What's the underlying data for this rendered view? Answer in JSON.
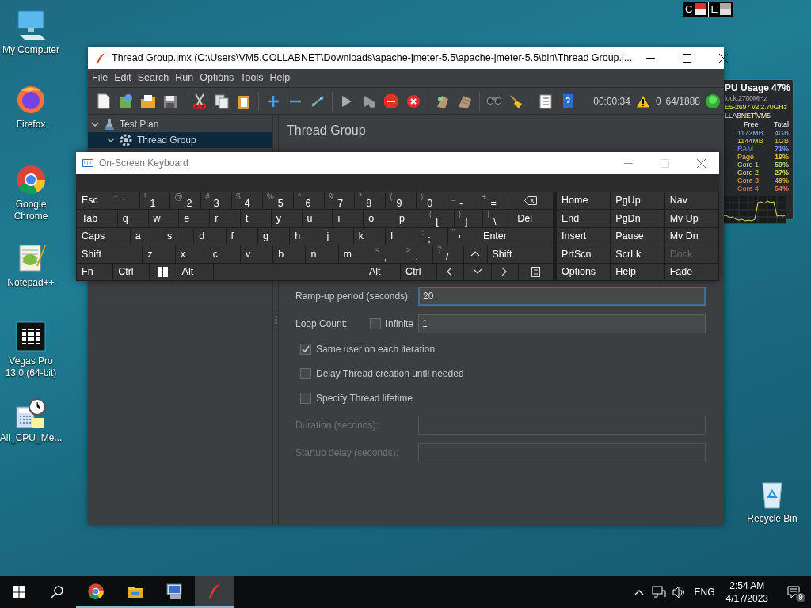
{
  "desktop_icons": [
    {
      "kind": "computer",
      "label": "My Computer"
    },
    {
      "kind": "firefox",
      "label": "Firefox"
    },
    {
      "kind": "chrome",
      "label": "Google Chrome"
    },
    {
      "kind": "notepad",
      "label": "Notepad++"
    },
    {
      "kind": "vegas",
      "label": "Vegas Pro 13.0 (64-bit)"
    },
    {
      "kind": "calc",
      "label": "All_CPU_Me..."
    },
    {
      "kind": "recycle",
      "label": "Recycle Bin"
    }
  ],
  "top_widget": {
    "left": "C",
    "right": "E"
  },
  "cpu_gadget": {
    "title": "PU Usage",
    "usage": "47%",
    "lines": [
      "lock:2700MHz",
      "E5-2697 v2 2.70GHz",
      "LLABNET\\VM5"
    ],
    "columns": [
      "Free",
      "Total"
    ],
    "memory": [
      {
        "free": "1172MB",
        "total": "4GB",
        "color": "#8fb4ea"
      },
      {
        "free": "1144MB",
        "total": "1GB",
        "color": "#e8c040"
      }
    ],
    "meters": [
      {
        "label": "RAM",
        "value": "71%",
        "color": "#7c9cff"
      },
      {
        "label": "Page",
        "value": "19%",
        "color": "#e8c040"
      },
      {
        "label": "Core 1",
        "value": "59%",
        "color": "#b8e080"
      },
      {
        "label": "Core 2",
        "value": "27%",
        "color": "#d8e060"
      },
      {
        "label": "Core 3",
        "value": "49%",
        "color": "#e8a840"
      },
      {
        "label": "Core 4",
        "value": "54%",
        "color": "#e87848"
      }
    ]
  },
  "jmeter": {
    "title": "Thread Group.jmx (C:\\Users\\VM5.COLLABNET\\Downloads\\apache-jmeter-5.5\\apache-jmeter-5.5\\bin\\Thread Group.j...",
    "menu": [
      "File",
      "Edit",
      "Search",
      "Run",
      "Options",
      "Tools",
      "Help"
    ],
    "status": {
      "elapsed": "00:00:34",
      "warnings": "0",
      "threads": "64/1888"
    },
    "tree": [
      {
        "label": "Test Plan",
        "expanded": true,
        "selected": false,
        "children": [
          {
            "label": "Thread Group",
            "expanded": true,
            "selected": true
          }
        ]
      }
    ],
    "panel_title": "Thread Group",
    "fields": [
      {
        "label": "Ramp-up period (seconds):",
        "value": "20",
        "focused": true
      },
      {
        "label": "Loop Count:",
        "checkbox": {
          "label": "Infinite",
          "checked": false
        },
        "value": "1",
        "focused": false
      }
    ],
    "options": [
      {
        "label": "Same user on each iteration",
        "checked": true
      },
      {
        "label": "Delay Thread creation until needed",
        "checked": false
      },
      {
        "label": "Specify Thread lifetime",
        "checked": false
      }
    ],
    "lifetime_fields": [
      {
        "label": "Duration (seconds):",
        "disabled": true
      },
      {
        "label": "Startup delay (seconds):",
        "disabled": true
      }
    ]
  },
  "keyboard": {
    "title": "On-Screen Keyboard",
    "rows": [
      {
        "keys": [
          {
            "kind": "text",
            "label": "Esc"
          },
          {
            "kind": "char",
            "shift": "~",
            "main": "`"
          },
          {
            "kind": "char",
            "shift": "!",
            "main": "1"
          },
          {
            "kind": "char",
            "shift": "@",
            "main": "2"
          },
          {
            "kind": "char",
            "shift": "#",
            "main": "3"
          },
          {
            "kind": "char",
            "shift": "$",
            "main": "4"
          },
          {
            "kind": "char",
            "shift": "%",
            "main": "5"
          },
          {
            "kind": "char",
            "shift": "^",
            "main": "6"
          },
          {
            "kind": "char",
            "shift": "&",
            "main": "7"
          },
          {
            "kind": "char",
            "shift": "*",
            "main": "8"
          },
          {
            "kind": "char",
            "shift": "(",
            "main": "9"
          },
          {
            "kind": "char",
            "shift": ")",
            "main": "0"
          },
          {
            "kind": "char",
            "shift": "_",
            "main": "-"
          },
          {
            "kind": "char",
            "shift": "+",
            "main": "="
          },
          {
            "kind": "backspace"
          }
        ]
      },
      {
        "keys": [
          {
            "kind": "text",
            "label": "Tab"
          },
          {
            "kind": "text",
            "label": "q"
          },
          {
            "kind": "text",
            "label": "w"
          },
          {
            "kind": "text",
            "label": "e"
          },
          {
            "kind": "text",
            "label": "r"
          },
          {
            "kind": "text",
            "label": "t"
          },
          {
            "kind": "text",
            "label": "y"
          },
          {
            "kind": "text",
            "label": "u"
          },
          {
            "kind": "text",
            "label": "i"
          },
          {
            "kind": "text",
            "label": "o"
          },
          {
            "kind": "text",
            "label": "p"
          },
          {
            "kind": "char",
            "shift": "{",
            "main": "["
          },
          {
            "kind": "char",
            "shift": "}",
            "main": "]"
          },
          {
            "kind": "char",
            "shift": "|",
            "main": "\\"
          },
          {
            "kind": "text",
            "label": "Del"
          }
        ]
      },
      {
        "keys": [
          {
            "kind": "text",
            "label": "Caps"
          },
          {
            "kind": "text",
            "label": "a"
          },
          {
            "kind": "text",
            "label": "s"
          },
          {
            "kind": "text",
            "label": "d"
          },
          {
            "kind": "text",
            "label": "f"
          },
          {
            "kind": "text",
            "label": "g"
          },
          {
            "kind": "text",
            "label": "h"
          },
          {
            "kind": "text",
            "label": "j"
          },
          {
            "kind": "text",
            "label": "k"
          },
          {
            "kind": "text",
            "label": "l"
          },
          {
            "kind": "char",
            "shift": ":",
            "main": ";"
          },
          {
            "kind": "char",
            "shift": "\"",
            "main": "'"
          },
          {
            "kind": "text",
            "label": "Enter"
          }
        ]
      },
      {
        "keys": [
          {
            "kind": "text",
            "label": "Shift"
          },
          {
            "kind": "text",
            "label": "z"
          },
          {
            "kind": "text",
            "label": "x"
          },
          {
            "kind": "text",
            "label": "c"
          },
          {
            "kind": "text",
            "label": "v"
          },
          {
            "kind": "text",
            "label": "b"
          },
          {
            "kind": "text",
            "label": "n"
          },
          {
            "kind": "text",
            "label": "m"
          },
          {
            "kind": "char",
            "shift": "<",
            "main": ","
          },
          {
            "kind": "char",
            "shift": ">",
            "main": "."
          },
          {
            "kind": "char",
            "shift": "?",
            "main": "/"
          },
          {
            "kind": "up"
          },
          {
            "kind": "text",
            "label": "Shift"
          }
        ]
      },
      {
        "keys": [
          {
            "kind": "text",
            "label": "Fn"
          },
          {
            "kind": "text",
            "label": "Ctrl"
          },
          {
            "kind": "windows"
          },
          {
            "kind": "text",
            "label": "Alt"
          },
          {
            "kind": "space"
          },
          {
            "kind": "text",
            "label": "Alt"
          },
          {
            "kind": "text",
            "label": "Ctrl"
          },
          {
            "kind": "left"
          },
          {
            "kind": "down"
          },
          {
            "kind": "right"
          },
          {
            "kind": "menu"
          }
        ]
      }
    ],
    "nav": [
      {
        "label": "Home",
        "disabled": false
      },
      {
        "label": "PgUp",
        "disabled": false
      },
      {
        "label": "Nav",
        "disabled": false
      },
      {
        "label": "End",
        "disabled": false
      },
      {
        "label": "PgDn",
        "disabled": false
      },
      {
        "label": "Mv Up",
        "disabled": false
      },
      {
        "label": "Insert",
        "disabled": false
      },
      {
        "label": "Pause",
        "disabled": false
      },
      {
        "label": "Mv Dn",
        "disabled": false
      },
      {
        "label": "PrtScn",
        "disabled": false
      },
      {
        "label": "ScrLk",
        "disabled": false
      },
      {
        "label": "Dock",
        "disabled": true
      },
      {
        "label": "Options",
        "disabled": false
      },
      {
        "label": "Help",
        "disabled": false
      },
      {
        "label": "Fade",
        "disabled": false
      }
    ]
  },
  "taskbar": {
    "apps": [
      {
        "kind": "chrome",
        "active": false
      },
      {
        "kind": "folder",
        "active": false
      },
      {
        "kind": "remote",
        "active": false
      },
      {
        "kind": "feather",
        "active": true
      }
    ],
    "language": "ENG",
    "time": "2:54 AM",
    "date": "4/17/2023",
    "notifications": "9"
  }
}
